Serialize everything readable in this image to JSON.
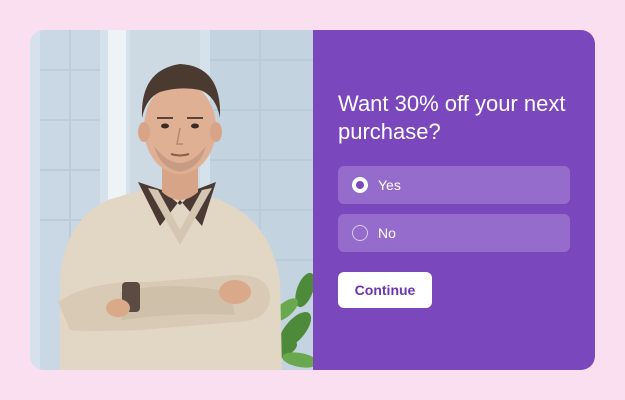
{
  "popup": {
    "question": "Want 30% off your next purchase?",
    "options": [
      {
        "label": "Yes",
        "selected": true
      },
      {
        "label": "No",
        "selected": false
      }
    ],
    "continue_label": "Continue"
  },
  "colors": {
    "page_background": "#f9dff0",
    "panel_background": "#7b47bd",
    "option_background": "#956ccb",
    "button_background": "#ffffff",
    "button_text": "#6a35b0"
  },
  "icons": {
    "selected_radio": "radio-checked-icon",
    "unselected_radio": "radio-unchecked-icon"
  }
}
